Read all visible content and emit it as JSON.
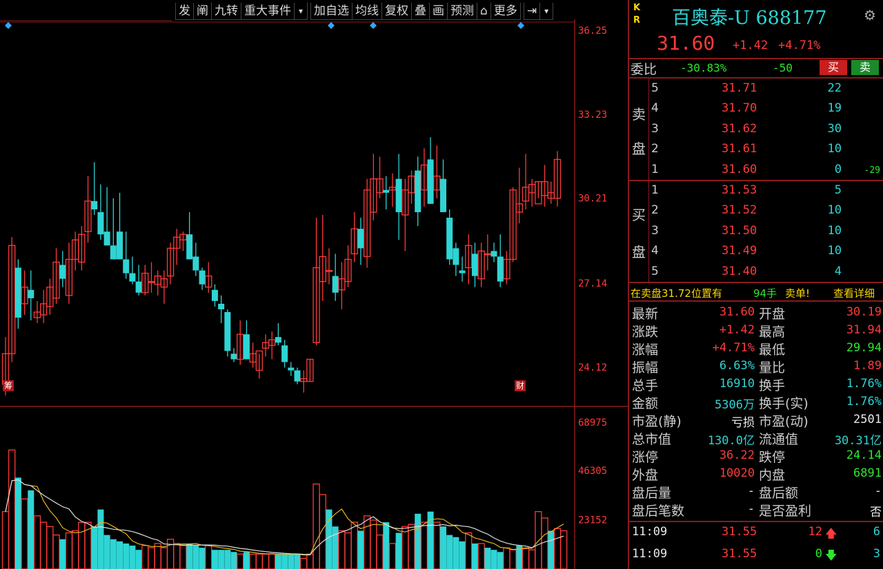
{
  "toolbar": {
    "items": [
      "发",
      "阐",
      "九转",
      "重大事件",
      "▾",
      "加自选",
      "均线",
      "复权",
      "叠",
      "画",
      "预测",
      "⌂",
      "更多",
      "⇥",
      "▾"
    ]
  },
  "price_axis": [
    "36.25",
    "33.23",
    "30.21",
    "27.14",
    "24.12"
  ],
  "volume_axis": [
    "68975",
    "46305",
    "23152"
  ],
  "chart_markers": {
    "left": "筹",
    "right": "财"
  },
  "colors": {
    "up": "#ff3b3b",
    "down": "#2fd4d4",
    "ma_yellow": "#e6b422",
    "ma_white": "#dddddd",
    "border": "#8a1a1a"
  },
  "chart_data": {
    "type": "candlestick",
    "candles": [
      [
        23.5,
        25.2,
        23.1,
        24.6
      ],
      [
        24.6,
        28.8,
        24.3,
        28.5
      ],
      [
        27.7,
        28.0,
        25.5,
        25.9
      ],
      [
        26.4,
        27.6,
        26.0,
        27.0
      ],
      [
        26.9,
        27.6,
        25.8,
        26.6
      ],
      [
        25.9,
        26.5,
        25.7,
        26.1
      ],
      [
        26.0,
        26.9,
        25.7,
        26.4
      ],
      [
        26.3,
        27.3,
        26.0,
        27.0
      ],
      [
        26.6,
        28.4,
        26.4,
        27.9
      ],
      [
        27.8,
        28.3,
        27.0,
        27.3
      ],
      [
        26.7,
        28.6,
        26.4,
        28.0
      ],
      [
        28.0,
        29.0,
        27.6,
        28.7
      ],
      [
        27.9,
        29.2,
        27.6,
        28.9
      ],
      [
        29.0,
        31.0,
        28.6,
        30.1
      ],
      [
        30.1,
        31.5,
        29.6,
        29.8
      ],
      [
        29.7,
        30.7,
        28.7,
        28.9
      ],
      [
        29.0,
        30.6,
        28.6,
        28.5
      ],
      [
        28.5,
        30.2,
        28.0,
        28.0
      ],
      [
        29.0,
        30.4,
        28.0,
        28.0
      ],
      [
        28.0,
        29.0,
        27.3,
        27.5
      ],
      [
        27.5,
        28.1,
        27.1,
        27.2
      ],
      [
        27.2,
        27.8,
        26.7,
        26.8
      ],
      [
        26.8,
        27.8,
        26.7,
        27.5
      ],
      [
        27.2,
        27.9,
        26.8,
        27.2
      ],
      [
        27.1,
        27.6,
        26.7,
        27.4
      ],
      [
        27.0,
        27.6,
        26.4,
        27.3
      ],
      [
        27.4,
        28.6,
        27.1,
        28.4
      ],
      [
        28.4,
        29.1,
        27.8,
        28.8
      ],
      [
        28.7,
        29.0,
        28.3,
        28.9
      ],
      [
        28.9,
        29.7,
        28.2,
        28.0
      ],
      [
        28.1,
        28.6,
        27.4,
        27.6
      ],
      [
        27.6,
        27.7,
        26.9,
        27.1
      ],
      [
        27.0,
        27.9,
        26.8,
        27.4
      ],
      [
        26.9,
        27.1,
        26.3,
        26.5
      ],
      [
        26.4,
        26.7,
        25.7,
        26.2
      ],
      [
        26.1,
        26.2,
        24.5,
        24.7
      ],
      [
        24.6,
        24.8,
        24.3,
        24.4
      ],
      [
        24.4,
        25.8,
        24.2,
        25.3
      ],
      [
        25.3,
        25.8,
        24.4,
        24.4
      ],
      [
        24.3,
        25.0,
        24.1,
        24.6
      ],
      [
        24.0,
        24.6,
        23.7,
        24.7
      ],
      [
        24.8,
        25.3,
        24.5,
        25.0
      ],
      [
        24.9,
        25.4,
        24.4,
        25.1
      ],
      [
        25.2,
        25.7,
        24.9,
        25.0
      ],
      [
        24.9,
        25.1,
        24.1,
        24.3
      ],
      [
        24.1,
        24.3,
        23.8,
        24.0
      ],
      [
        24.0,
        24.1,
        23.5,
        23.6
      ],
      [
        23.6,
        24.0,
        23.2,
        23.7
      ],
      [
        23.6,
        24.4,
        23.6,
        24.4
      ],
      [
        25.0,
        29.5,
        24.9,
        27.7
      ],
      [
        27.2,
        29.6,
        26.5,
        28.1
      ],
      [
        27.6,
        28.4,
        27.1,
        27.6
      ],
      [
        27.4,
        28.2,
        26.5,
        26.8
      ],
      [
        26.9,
        27.9,
        26.2,
        27.3
      ],
      [
        27.2,
        28.5,
        27.0,
        28.0
      ],
      [
        28.2,
        29.7,
        27.9,
        29.1
      ],
      [
        29.1,
        29.5,
        27.8,
        28.4
      ],
      [
        28.1,
        30.9,
        27.7,
        30.5
      ],
      [
        29.7,
        31.8,
        29.4,
        30.9
      ],
      [
        30.4,
        31.7,
        30.2,
        30.9
      ],
      [
        30.5,
        31.0,
        29.8,
        30.4
      ],
      [
        30.5,
        31.1,
        29.9,
        30.6
      ],
      [
        30.9,
        31.8,
        28.7,
        29.7
      ],
      [
        29.6,
        30.9,
        28.3,
        30.5
      ],
      [
        30.4,
        31.2,
        30.0,
        31.0
      ],
      [
        31.2,
        31.7,
        29.2,
        29.7
      ],
      [
        30.5,
        32.0,
        29.9,
        31.4
      ],
      [
        31.6,
        32.4,
        30.0,
        30.0
      ],
      [
        30.5,
        32.1,
        30.2,
        31.0
      ],
      [
        30.9,
        31.6,
        30.0,
        29.7
      ],
      [
        29.5,
        29.8,
        27.8,
        28.0
      ],
      [
        28.4,
        28.6,
        27.4,
        27.8
      ],
      [
        27.6,
        28.1,
        27.2,
        27.5
      ],
      [
        27.7,
        28.9,
        27.1,
        28.5
      ],
      [
        28.2,
        28.6,
        27.0,
        27.4
      ],
      [
        27.3,
        28.6,
        27.0,
        28.3
      ],
      [
        28.2,
        28.9,
        27.6,
        28.2
      ],
      [
        28.3,
        28.6,
        27.9,
        28.1
      ],
      [
        28.1,
        28.9,
        27.0,
        27.2
      ],
      [
        27.3,
        28.3,
        27.1,
        28.0
      ],
      [
        28.0,
        30.6,
        27.9,
        30.5
      ],
      [
        29.7,
        31.3,
        29.3,
        30.0
      ],
      [
        30.1,
        31.8,
        29.8,
        30.6
      ],
      [
        30.4,
        30.9,
        29.9,
        30.7
      ],
      [
        30.0,
        30.8,
        30.2,
        30.8
      ],
      [
        30.3,
        31.4,
        29.9,
        30.8
      ],
      [
        30.2,
        30.8,
        30.0,
        30.4
      ],
      [
        30.2,
        31.9,
        29.9,
        31.6
      ]
    ],
    "volumes": [
      27,
      56,
      43,
      33,
      37,
      25,
      22,
      20,
      16,
      14,
      17,
      18,
      22,
      22,
      20,
      28,
      16,
      14,
      13,
      12,
      11,
      9,
      11,
      10,
      12,
      10,
      14,
      12,
      11,
      12,
      11,
      10,
      11,
      9,
      9,
      9,
      8,
      7,
      8,
      7,
      7,
      7,
      7,
      7,
      7,
      7,
      7,
      5,
      7,
      40,
      35,
      28,
      20,
      18,
      17,
      22,
      18,
      25,
      23,
      16,
      22,
      12,
      17,
      20,
      21,
      26,
      22,
      27,
      22,
      20,
      16,
      15,
      13,
      17,
      12,
      12,
      10,
      9,
      8,
      10,
      9,
      11,
      10,
      9,
      27,
      24,
      18,
      19,
      18
    ],
    "volume_up": [
      1,
      1,
      0,
      1,
      0,
      1,
      1,
      1,
      1,
      0,
      1,
      1,
      1,
      1,
      0,
      0,
      0,
      0,
      0,
      0,
      0,
      0,
      1,
      1,
      1,
      1,
      1,
      1,
      1,
      0,
      0,
      0,
      1,
      0,
      0,
      0,
      0,
      1,
      0,
      1,
      1,
      1,
      1,
      0,
      0,
      0,
      0,
      1,
      1,
      1,
      1,
      0,
      0,
      1,
      1,
      1,
      0,
      1,
      1,
      1,
      0,
      1,
      0,
      1,
      1,
      0,
      1,
      0,
      1,
      0,
      0,
      0,
      0,
      1,
      0,
      1,
      0,
      0,
      0,
      1,
      1,
      0,
      1,
      1,
      1,
      1,
      0,
      1,
      1
    ],
    "price_ylim": [
      22.8,
      36.5
    ],
    "volume_ylim": [
      0,
      70000
    ]
  },
  "panel": {
    "kr_top": "K",
    "kr_bottom": "R",
    "name": "百奥泰-U 688177",
    "price": "31.60",
    "change": "+1.42",
    "change_pct": "+4.71%",
    "weibi_label": "委比",
    "weibi_pct": "-30.83%",
    "weibi_diff": "-50",
    "buy_btn": "买",
    "sell_btn": "卖",
    "sell_side_label": [
      "卖",
      "盘"
    ],
    "buy_side_label": [
      "买",
      "盘"
    ],
    "asks": [
      {
        "lvl": "5",
        "price": "31.71",
        "vol": "22",
        "chg": ""
      },
      {
        "lvl": "4",
        "price": "31.70",
        "vol": "19",
        "chg": ""
      },
      {
        "lvl": "3",
        "price": "31.62",
        "vol": "30",
        "chg": ""
      },
      {
        "lvl": "2",
        "price": "31.61",
        "vol": "10",
        "chg": ""
      },
      {
        "lvl": "1",
        "price": "31.60",
        "vol": "0",
        "chg": "-29"
      }
    ],
    "bids": [
      {
        "lvl": "1",
        "price": "31.53",
        "vol": "5"
      },
      {
        "lvl": "2",
        "price": "31.52",
        "vol": "10"
      },
      {
        "lvl": "3",
        "price": "31.50",
        "vol": "10"
      },
      {
        "lvl": "4",
        "price": "31.49",
        "vol": "10"
      },
      {
        "lvl": "5",
        "price": "31.40",
        "vol": "4"
      }
    ],
    "notice_prefix": "在卖盘31.72位置有",
    "notice_qty": "94手",
    "notice_suffix": "卖单!",
    "notice_link": "查看详细",
    "quotes": [
      {
        "l1": "最新",
        "v1": "31.60",
        "c1": "red",
        "l2": "开盘",
        "v2": "30.19",
        "c2": "red"
      },
      {
        "l1": "涨跌",
        "v1": "+1.42",
        "c1": "red",
        "l2": "最高",
        "v2": "31.94",
        "c2": "red"
      },
      {
        "l1": "涨幅",
        "v1": "+4.71%",
        "c1": "red",
        "l2": "最低",
        "v2": "29.94",
        "c2": "green"
      },
      {
        "l1": "振幅",
        "v1": "6.63%",
        "c1": "cyan",
        "l2": "量比",
        "v2": "1.89",
        "c2": "red"
      },
      {
        "l1": "总手",
        "v1": "16910",
        "c1": "cyan",
        "l2": "换手",
        "v2": "1.76%",
        "c2": "cyan"
      },
      {
        "l1": "金额",
        "v1": "5306万",
        "c1": "cyan",
        "l2": "换手(实)",
        "v2": "1.76%",
        "c2": "cyan"
      },
      {
        "l1": "市盈(静)",
        "v1": "亏损",
        "c1": "white",
        "l2": "市盈(动)",
        "v2": "2501",
        "c2": "white"
      },
      {
        "l1": "总市值",
        "v1": "130.0亿",
        "c1": "cyan",
        "l2": "流通值",
        "v2": "30.31亿",
        "c2": "cyan"
      },
      {
        "l1": "涨停",
        "v1": "36.22",
        "c1": "red",
        "l2": "跌停",
        "v2": "24.14",
        "c2": "green"
      },
      {
        "l1": "外盘",
        "v1": "10020",
        "c1": "red",
        "l2": "内盘",
        "v2": "6891",
        "c2": "green"
      },
      {
        "l1": "盘后量",
        "v1": "-",
        "c1": "white",
        "l2": "盘后额",
        "v2": "-",
        "c2": "white"
      },
      {
        "l1": "盘后笔数",
        "v1": "-",
        "c1": "white",
        "l2": "是否盈利",
        "v2": "否",
        "c2": "white"
      }
    ],
    "ticks": [
      {
        "time": "11:09",
        "price": "31.55",
        "vol": "12",
        "dir": "up",
        "cnt": "6"
      },
      {
        "time": "11:09",
        "price": "31.55",
        "vol": "0",
        "dir": "down",
        "cnt": "3"
      }
    ]
  }
}
